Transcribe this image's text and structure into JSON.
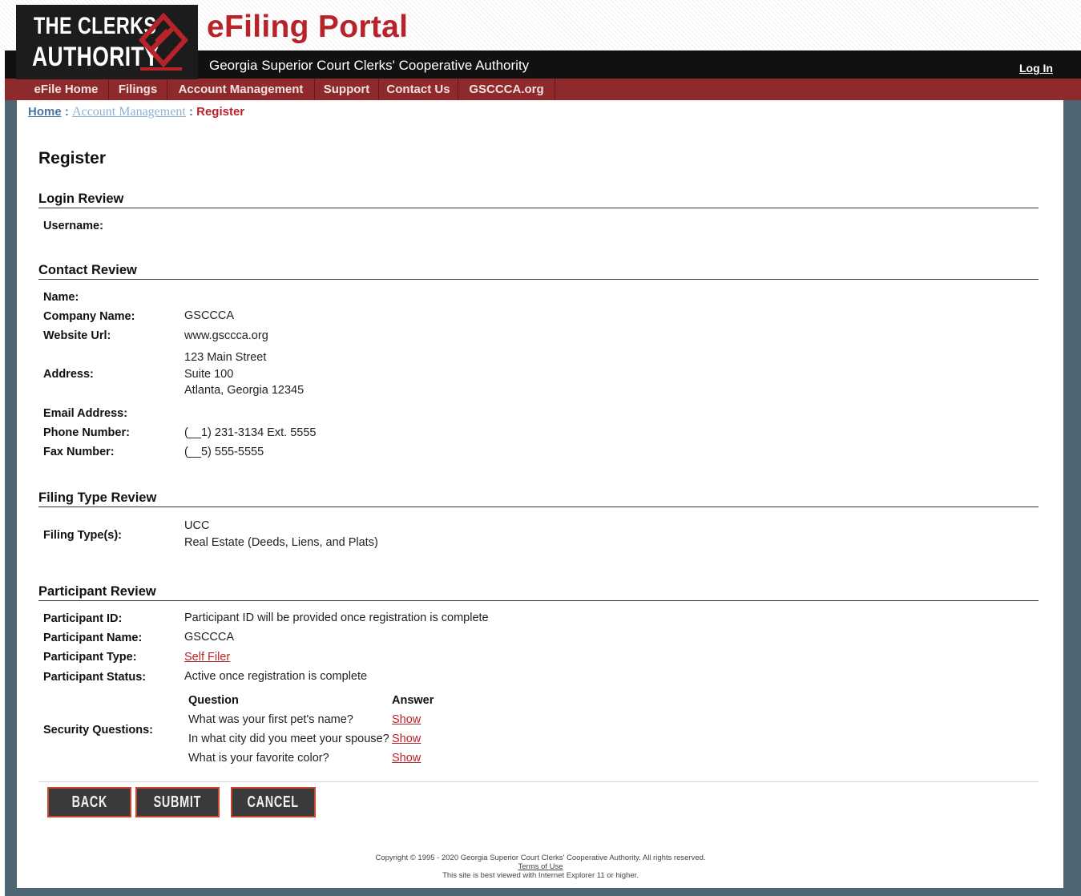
{
  "header": {
    "logo_line1": "THE CLERKS",
    "logo_line2": "AUTHORITY",
    "portal_title": "eFiling Portal",
    "tagline": "Georgia Superior Court Clerks' Cooperative Authority",
    "login_label": "Log In"
  },
  "nav": {
    "items": [
      {
        "label": "eFile Home"
      },
      {
        "label": "Filings"
      },
      {
        "label": "Account Management"
      },
      {
        "label": "Support"
      },
      {
        "label": "Contact Us"
      },
      {
        "label": "GSCCCA.org"
      }
    ]
  },
  "breadcrumb": {
    "home": "Home",
    "separator": ":",
    "account": "Account Management",
    "current": "Register"
  },
  "page": {
    "title": "Register"
  },
  "login_review": {
    "heading": "Login Review",
    "username_label": "Username:",
    "username_value": ""
  },
  "contact_review": {
    "heading": "Contact Review",
    "name_label": "Name:",
    "name_value": "",
    "company_label": "Company Name:",
    "company_value": "GSCCCA",
    "website_label": "Website Url:",
    "website_value": "www.gsccca.org",
    "address_label": "Address:",
    "address_lines": [
      "123 Main Street",
      "Suite 100",
      "Atlanta, Georgia 12345"
    ],
    "email_label": "Email Address:",
    "email_value": "",
    "phone_label": "Phone Number:",
    "phone_value": "(__1) 231-3134 Ext. 5555",
    "fax_label": "Fax Number:",
    "fax_value": "(__5) 555-5555"
  },
  "filing_type_review": {
    "heading": "Filing Type Review",
    "label": "Filing Type(s):",
    "types": [
      "UCC",
      "Real Estate (Deeds, Liens, and Plats)"
    ]
  },
  "participant_review": {
    "heading": "Participant Review",
    "id_label": "Participant ID:",
    "id_value": "Participant ID will be provided once registration is complete",
    "name_label": "Participant Name:",
    "name_value": "GSCCCA",
    "type_label": "Participant Type:",
    "type_value": "Self Filer",
    "status_label": "Participant Status:",
    "status_value": "Active once registration is complete",
    "security_label": "Security Questions:",
    "question_header": "Question",
    "answer_header": "Answer",
    "questions": [
      {
        "question": "What was your first pet's name?",
        "answer": "Show"
      },
      {
        "question": "In what city did you meet your spouse?",
        "answer": "Show"
      },
      {
        "question": "What is your favorite color?",
        "answer": "Show"
      }
    ]
  },
  "buttons": {
    "back": "BACK",
    "submit": "SUBMIT",
    "cancel": "CANCEL"
  },
  "footer": {
    "copyright": "Copyright © 1995 - 2020 Georgia Superior Court Clerks' Cooperative Authority. All rights reserved.",
    "terms": "Terms of Use",
    "browser_note": "This site is best viewed with Internet Explorer 11 or higher."
  },
  "colors": {
    "brand_red": "#b8232a",
    "nav_bg": "#8e2a2b",
    "frame": "#4e6671",
    "button_bg": "#3a3a3a",
    "button_border": "#c9472c"
  }
}
